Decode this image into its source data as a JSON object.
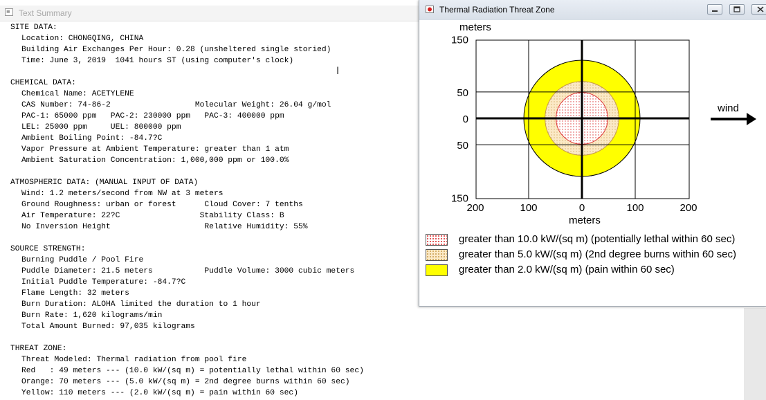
{
  "text_summary": {
    "title": "Text Summary",
    "lines": [
      {
        "text": "SITE DATA:",
        "indent": false
      },
      {
        "text": "Location: CHONGQING, CHINA",
        "indent": true
      },
      {
        "text": "Building Air Exchanges Per Hour: 0.28 (unsheltered single storied)",
        "indent": true
      },
      {
        "text": "Time: June 3, 2019  1041 hours ST (using computer's clock)",
        "indent": true
      },
      {
        "text": "",
        "indent": false
      },
      {
        "text": "CHEMICAL DATA:",
        "indent": false
      },
      {
        "text": "Chemical Name: ACETYLENE",
        "indent": true
      },
      {
        "text": "CAS Number: 74-86-2                  Molecular Weight: 26.04 g/mol",
        "indent": true
      },
      {
        "text": "PAC-1: 65000 ppm   PAC-2: 230000 ppm   PAC-3: 400000 ppm",
        "indent": true
      },
      {
        "text": "LEL: 25000 ppm     UEL: 800000 ppm",
        "indent": true
      },
      {
        "text": "Ambient Boiling Point: -84.7?C",
        "indent": true
      },
      {
        "text": "Vapor Pressure at Ambient Temperature: greater than 1 atm",
        "indent": true
      },
      {
        "text": "Ambient Saturation Concentration: 1,000,000 ppm or 100.0%",
        "indent": true
      },
      {
        "text": "",
        "indent": false
      },
      {
        "text": "ATMOSPHERIC DATA: (MANUAL INPUT OF DATA)",
        "indent": false
      },
      {
        "text": "Wind: 1.2 meters/second from NW at 3 meters",
        "indent": true
      },
      {
        "text": "Ground Roughness: urban or forest      Cloud Cover: 7 tenths",
        "indent": true
      },
      {
        "text": "Air Temperature: 22?C                 Stability Class: B",
        "indent": true
      },
      {
        "text": "No Inversion Height                    Relative Humidity: 55%",
        "indent": true
      },
      {
        "text": "",
        "indent": false
      },
      {
        "text": "SOURCE STRENGTH:",
        "indent": false
      },
      {
        "text": "Burning Puddle / Pool Fire",
        "indent": true
      },
      {
        "text": "Puddle Diameter: 21.5 meters           Puddle Volume: 3000 cubic meters",
        "indent": true
      },
      {
        "text": "Initial Puddle Temperature: -84.7?C",
        "indent": true
      },
      {
        "text": "Flame Length: 32 meters",
        "indent": true
      },
      {
        "text": "Burn Duration: ALOHA limited the duration to 1 hour",
        "indent": true
      },
      {
        "text": "Burn Rate: 1,620 kilograms/min",
        "indent": true
      },
      {
        "text": "Total Amount Burned: 97,035 kilograms",
        "indent": true
      },
      {
        "text": "",
        "indent": false
      },
      {
        "text": "THREAT ZONE:",
        "indent": false
      },
      {
        "text": "Threat Modeled: Thermal radiation from pool fire",
        "indent": true
      },
      {
        "text": "Red   : 49 meters --- (10.0 kW/(sq m) = potentially lethal within 60 sec)",
        "indent": true
      },
      {
        "text": "Orange: 70 meters --- (5.0 kW/(sq m) = 2nd degree burns within 60 sec)",
        "indent": true
      },
      {
        "text": "Yellow: 110 meters --- (2.0 kW/(sq m) = pain within 60 sec)",
        "indent": true
      }
    ]
  },
  "thermal_window": {
    "title": "Thermal Radiation Threat Zone",
    "legend": [
      {
        "label": "greater than 10.0 kW/(sq m) (potentially lethal within 60 sec)",
        "color": "#dd3333"
      },
      {
        "label": "greater than 5.0 kW/(sq m) (2nd degree burns within 60 sec)",
        "color": "#fbe9c6"
      },
      {
        "label": "greater than 2.0 kW/(sq m) (pain within 60 sec)",
        "color": "#ffff00"
      }
    ]
  },
  "chart_data": {
    "type": "threat-zone",
    "ylabel": "meters",
    "xlabel": "meters",
    "wind_label": "wind",
    "x_ticks": [
      "200",
      "100",
      "0",
      "100",
      "200"
    ],
    "y_ticks": [
      "150",
      "50",
      "0",
      "50",
      "150"
    ],
    "xlim": [
      -200,
      200
    ],
    "ylim": [
      -150,
      150
    ],
    "zones": [
      {
        "name": "Yellow",
        "radius": 110,
        "color": "#ffff00"
      },
      {
        "name": "Orange",
        "radius": 70,
        "color": "#fbe9c6"
      },
      {
        "name": "Red",
        "radius": 49,
        "color": "#dd3333"
      }
    ]
  }
}
